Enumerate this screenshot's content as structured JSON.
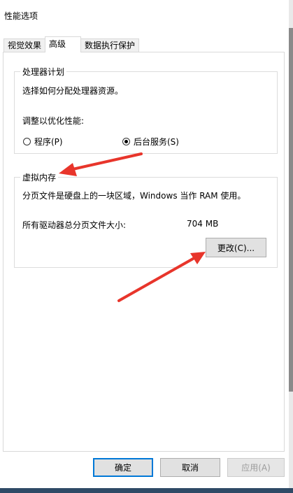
{
  "window": {
    "title": "性能选项"
  },
  "tabs": [
    {
      "label": "视觉效果"
    },
    {
      "label": "高级"
    },
    {
      "label": "数据执行保护"
    }
  ],
  "processor_group": {
    "legend": "处理器计划",
    "description": "选择如何分配处理器资源。",
    "optimize_label": "调整以优化性能:",
    "options": [
      {
        "label": "程序(P)",
        "selected": false
      },
      {
        "label": "后台服务(S)",
        "selected": true
      }
    ]
  },
  "virtual_memory_group": {
    "legend": "虚拟内存",
    "description": "分页文件是硬盘上的一块区域，Windows 当作 RAM 使用。",
    "total_label": "所有驱动器总分页文件大小:",
    "total_value": "704 MB",
    "change_button": "更改(C)..."
  },
  "footer": {
    "ok": "确定",
    "cancel": "取消",
    "apply": "应用(A)"
  },
  "colors": {
    "annotation_arrow": "#e8352b",
    "default_button_border": "#0078d7"
  }
}
